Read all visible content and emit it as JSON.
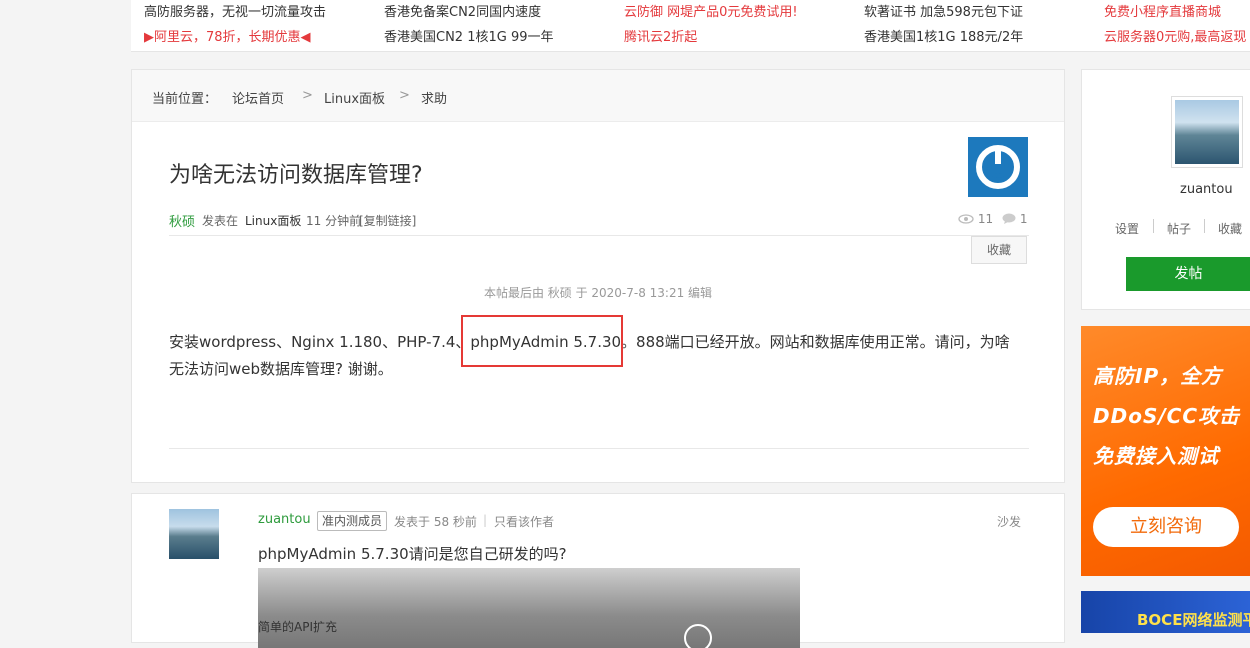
{
  "ads": {
    "row1": [
      "高防服务器，无视一切流量攻击",
      "香港免备案CN2同国内速度",
      "云防御 网堤产品0元免费试用!",
      "软著证书 加急598元包下证",
      "免费小程序直播商城"
    ],
    "row2": [
      "▶阿里云，78折，长期优惠◀",
      "香港美国CN2 1核1G 99一年",
      "腾讯云2折起",
      "香港美国1核1G 188元/2年",
      "云服务器0元购,最高返现"
    ]
  },
  "breadcrumb": {
    "prefix": "当前位置：",
    "items": [
      "论坛首页",
      "Linux面板",
      "求助"
    ],
    "sep": ">"
  },
  "post": {
    "title": "为啥无法访问数据库管理?",
    "author": "秋硕",
    "posted_in_label": "发表在",
    "board": "Linux面板",
    "time": "11 分钟前",
    "copy_link": "[复制链接]",
    "views": "11",
    "replies": "1",
    "favorite_label": "收藏",
    "edited_note": "本帖最后由 秋硕 于 2020-7-8 13:21 编辑",
    "body_line1": "安装wordpress、Nginx 1.180、PHP-7.4、phpMyAdmin 5.7.30。888端口已经开放。网站和数据库使用正常。请问，为啥",
    "body_line2": "无法访问web数据库管理? 谢谢。"
  },
  "reply": {
    "user": "zuantou",
    "badge": "准内测成员",
    "posted": "发表于 58 秒前",
    "sep": "|",
    "only_author": "只看该作者",
    "floor": "沙发",
    "text": "phpMyAdmin 5.7.30请问是您自己研发的吗?",
    "image_caption": "简单的API扩充"
  },
  "sidebar": {
    "username": "zuantou",
    "links": [
      "设置",
      "帖子",
      "收藏"
    ],
    "post_button": "发帖"
  },
  "banner1": {
    "lines": [
      "高防IP，全方",
      "DDoS/CC攻击",
      "免费接入测试"
    ],
    "button": "立刻咨询"
  },
  "banner2": {
    "text": "BOCE网络监测平"
  },
  "colors": {
    "green": "#2e9b3d",
    "red_link": "#e4393c",
    "post_button": "#1a9a2c",
    "highlight_box": "#e53935"
  }
}
